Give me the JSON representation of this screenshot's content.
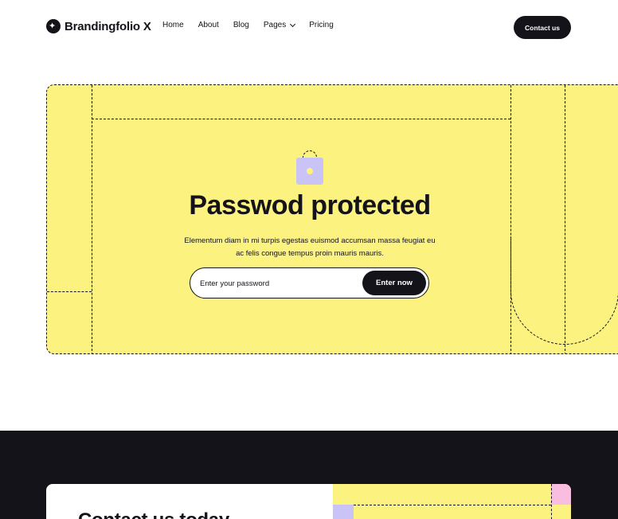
{
  "brand": {
    "name": "Brandingfolio X",
    "icon": "sparkle-icon"
  },
  "nav": {
    "items": [
      {
        "label": "Home"
      },
      {
        "label": "About"
      },
      {
        "label": "Blog"
      },
      {
        "label": "Pages",
        "has_dropdown": true
      },
      {
        "label": "Pricing"
      }
    ],
    "cta": "Contact us"
  },
  "hero": {
    "icon": "lock-icon",
    "title": "Passwod protected",
    "description": "Elementum diam in mi turpis egestas euismod accumsan massa feugiat eu ac felis congue tempus proin mauris mauris.",
    "password_placeholder": "Enter your password",
    "submit_label": "Enter now"
  },
  "footer_section": {
    "title": "Contact us today"
  },
  "colors": {
    "yellow": "#fcf27f",
    "dark": "#14131a",
    "lavender": "#c9c4f5",
    "pink": "#f9bde0"
  }
}
